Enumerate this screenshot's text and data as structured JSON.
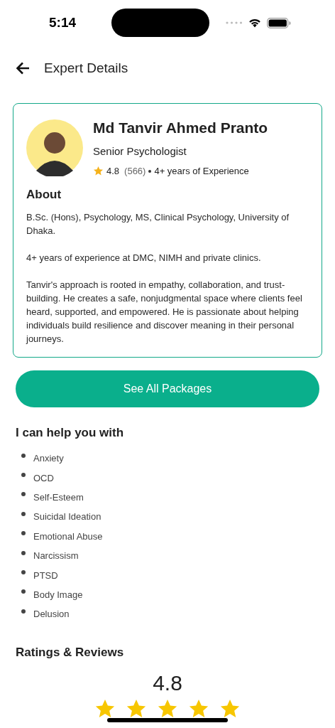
{
  "status_bar": {
    "time": "5:14"
  },
  "header": {
    "title": "Expert Details"
  },
  "expert": {
    "name": "Md Tanvir Ahmed Pranto",
    "role": "Senior Psychologist",
    "rating": "4.8",
    "review_count": "(566)",
    "experience": "4+ years of Experience"
  },
  "about": {
    "heading": "About",
    "paragraphs": [
      "B.Sc. (Hons), Psychology, MS, Clinical Psychology, University of Dhaka.",
      "4+ years of experience at DMC, NIMH and private clinics.",
      "Tanvir's approach is rooted in empathy, collaboration, and trust-building. He creates a safe, nonjudgmental space where clients feel heard, supported, and empowered. He is passionate about helping individuals build resilience and discover meaning in their personal journeys."
    ]
  },
  "packages_button": {
    "label": "See All Packages"
  },
  "help": {
    "heading": "I can help you with",
    "items": [
      "Anxiety",
      "OCD",
      "Self-Esteem",
      "Suicidal Ideation",
      "Emotional Abuse",
      "Narcissism",
      "PTSD",
      "Body Image",
      "Delusion"
    ]
  },
  "ratings": {
    "heading": "Ratings & Reviews",
    "score": "4.8",
    "stars": 5
  }
}
